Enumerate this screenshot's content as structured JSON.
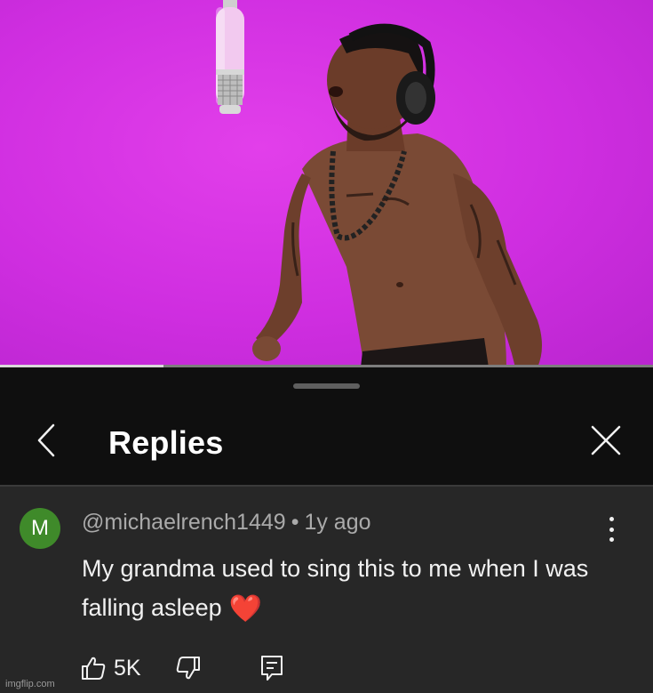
{
  "video": {
    "progress_fraction": 0.25,
    "background_color": "#d033e3",
    "progress_fill_color": "#d9d9d9"
  },
  "sheet": {
    "title": "Replies",
    "back_icon": "chevron-left-icon",
    "close_icon": "close-icon"
  },
  "comment": {
    "avatar_letter": "M",
    "avatar_color": "#3f8a2a",
    "author": "@michaelrench1449",
    "separator": "•",
    "age": "1y ago",
    "text": "My grandma used to sing this to me when I was falling asleep",
    "emoji": "❤️",
    "like_count": "5K",
    "menu_icon": "more-vertical-icon"
  },
  "watermark": "imgflip.com"
}
